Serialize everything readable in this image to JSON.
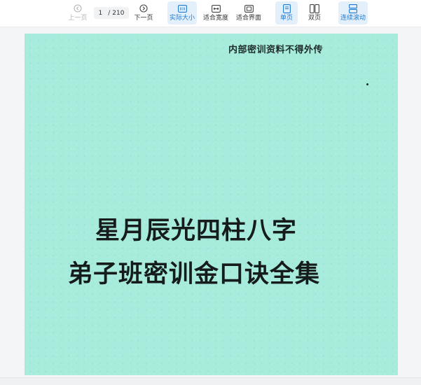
{
  "toolbar": {
    "prev_label": "上一页",
    "next_label": "下一页",
    "page_current": "1",
    "page_separator": "/",
    "page_total": "210",
    "actual_size_label": "实际大小",
    "fit_width_label": "适合宽度",
    "fit_page_label": "适合界面",
    "single_page_label": "单页",
    "double_page_label": "双页",
    "continuous_scroll_label": "连续滚动",
    "accent_color": "#1f7ad1"
  },
  "document": {
    "notice": "内部密训资料不得外传",
    "title_line_1": "星月辰光四柱八字",
    "title_line_2": "弟子班密训金口诀全集",
    "cover_color": "#a6ebdb"
  }
}
